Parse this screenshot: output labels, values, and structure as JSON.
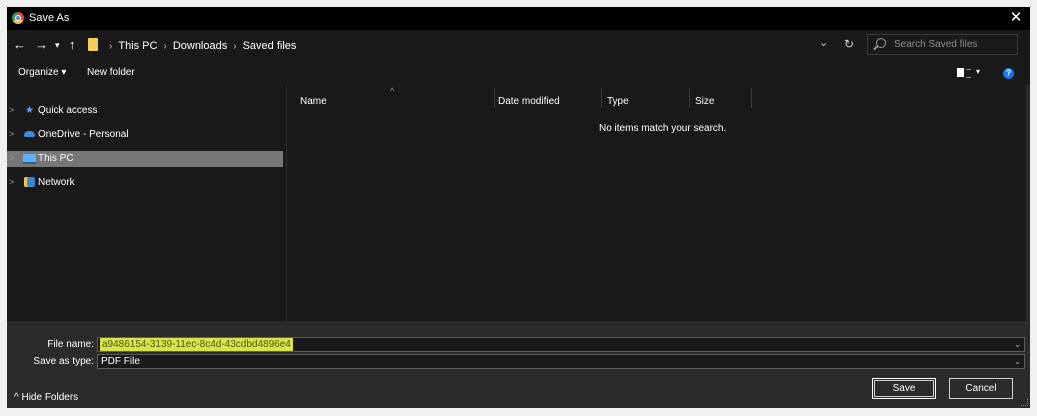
{
  "window": {
    "title": "Save As",
    "close_glyph": "✕"
  },
  "nav": {
    "back_glyph": "←",
    "forward_glyph": "→",
    "recent_glyph": "▾",
    "up_glyph": "↑",
    "breadcrumbs": [
      "This PC",
      "Downloads",
      "Saved files"
    ],
    "crumb_separator": "›",
    "dropdown_glyph": "⌄",
    "refresh_glyph": "↻",
    "search_placeholder": "Search Saved files"
  },
  "toolbar": {
    "organize_label": "Organize ▾",
    "new_folder_label": "New folder",
    "view_arrow": "▾",
    "help_glyph": "?"
  },
  "sidebar": {
    "items": [
      {
        "label": "Quick access",
        "icon": "star-icon"
      },
      {
        "label": "OneDrive - Personal",
        "icon": "cloud-icon"
      },
      {
        "label": "This PC",
        "icon": "computer-icon",
        "selected": true
      },
      {
        "label": "Network",
        "icon": "network-icon"
      }
    ],
    "chevron_glyph": ">"
  },
  "filelist": {
    "columns": [
      "Name",
      "Date modified",
      "Type",
      "Size"
    ],
    "sort_glyph": "^",
    "empty_message": "No items match your search."
  },
  "form": {
    "file_name_label": "File name:",
    "file_name_value": "a9486154-3139-11ec-8c4d-43cdbd4896e4",
    "save_type_label": "Save as type:",
    "save_type_value": "PDF File",
    "dropdown_glyph": "⌄"
  },
  "footer": {
    "hide_folders_label": "^ Hide Folders",
    "save_label": "Save",
    "cancel_label": "Cancel"
  },
  "colors": {
    "background": "#191919",
    "bottom_panel": "#2b2b2b",
    "selection": "#777777",
    "filename_highlight": "#d9e44a"
  }
}
